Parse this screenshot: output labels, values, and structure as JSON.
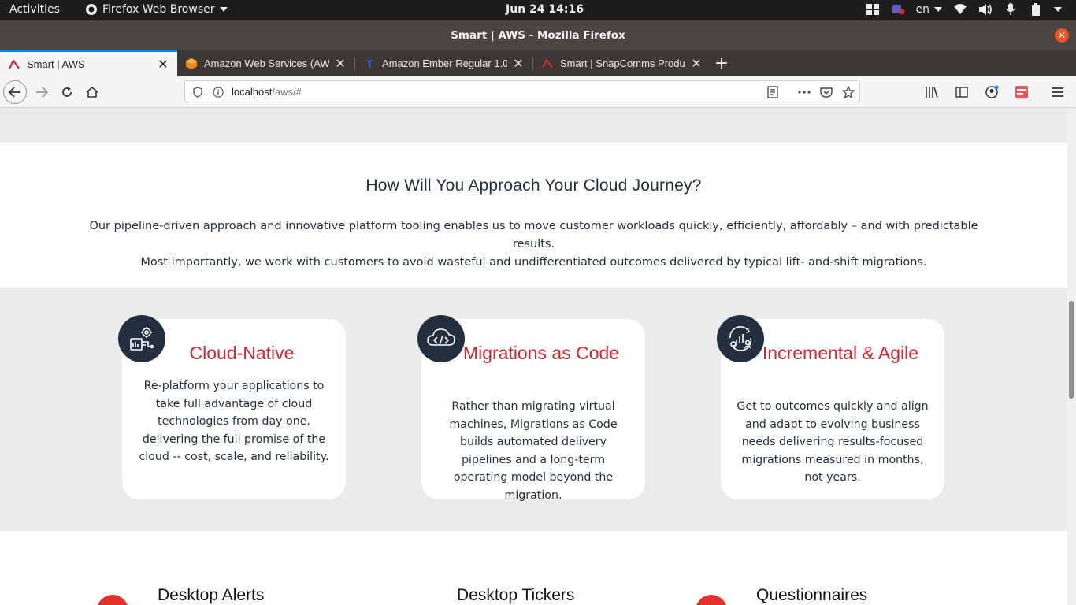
{
  "system_bar": {
    "activities": "Activities",
    "app_name": "Firefox Web Browser",
    "clock": "Jun 24  14:16",
    "language": "en"
  },
  "window": {
    "title": "Smart | AWS - Mozilla Firefox"
  },
  "tabs": [
    {
      "label": "Smart | AWS",
      "active": true
    },
    {
      "label": "Amazon Web Services (AWS",
      "active": false
    },
    {
      "label": "Amazon Ember Regular 1.0",
      "active": false
    },
    {
      "label": "Smart | SnapComms Produ",
      "active": false
    }
  ],
  "navbar": {
    "url_host": "localhost",
    "url_path": "/aws/#"
  },
  "colors": {
    "brand_dark": "#232f3e",
    "accent_red": "#d2262f",
    "band_grey": "#ebebeb"
  },
  "intro": {
    "heading": "How Will You Approach Your Cloud Journey?",
    "paragraph_line1": "Our pipeline-driven approach and innovative platform tooling enables us to move customer workloads quickly, efficiently, affordably – and with predictable results.",
    "paragraph_line2": "Most importantly, we work with customers to avoid wasteful and undifferentiated outcomes delivered by typical lift- and-shift migrations."
  },
  "cards": [
    {
      "icon": "cloud-native-gear-icon",
      "title": "Cloud-Native",
      "body": "Re-platform your applications to take full advantage of cloud technologies from day one, delivering the full promise of the cloud -- cost, scale, and reliability."
    },
    {
      "icon": "cloud-code-icon",
      "title": "Migrations as Code",
      "body": "Rather than migrating virtual machines, Migrations as Code builds automated delivery pipelines and a long-term operating model beyond the migration."
    },
    {
      "icon": "agile-growth-icon",
      "title": "Incremental & Agile",
      "body": "Get to outcomes quickly and align and adapt to evolving business needs delivering results-focused migrations measured in months, not years."
    }
  ],
  "features": [
    {
      "label": "Desktop Alerts"
    },
    {
      "label": "Desktop Tickers"
    },
    {
      "label": "Questionnaires"
    }
  ]
}
